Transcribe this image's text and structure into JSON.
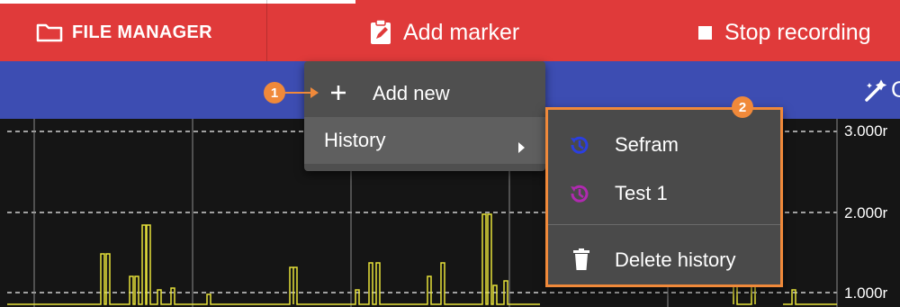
{
  "toolbar": {
    "file_manager_label": "FILE MANAGER",
    "add_marker_label": "Add marker",
    "stop_recording_label": "Stop recording",
    "accent_color": "#e03a3a"
  },
  "secondary_bar": {
    "color": "#3d4db2",
    "right_icon": "wand-icon",
    "right_text_fragment": "C"
  },
  "marker_menu": {
    "add_new_label": "Add new",
    "history_label": "History"
  },
  "history_submenu": {
    "items": [
      {
        "label": "Sefram",
        "icon": "history-icon",
        "icon_color": "#2b3fe0"
      },
      {
        "label": "Test 1",
        "icon": "history-icon",
        "icon_color": "#b02ab0"
      }
    ],
    "delete_label": "Delete history"
  },
  "callouts": {
    "first": "1",
    "second": "2",
    "color": "#f0893a"
  },
  "plot": {
    "axis_labels": [
      "3.000r",
      "2.000r",
      "1.000r"
    ],
    "trace_color": "#e6e23a"
  }
}
